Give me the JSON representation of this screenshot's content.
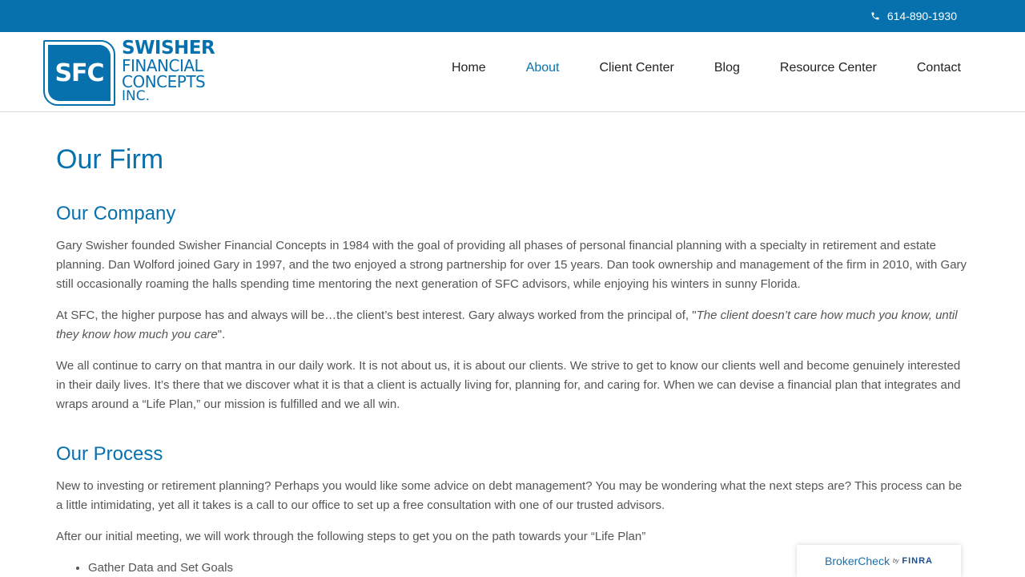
{
  "topbar": {
    "phone": "614-890-1930",
    "phone_icon": "phone-icon"
  },
  "logo": {
    "mark": "SFC",
    "line1": "SWISHER",
    "line2": "FINANCIAL",
    "line3": "CONCEPTS",
    "line4": "INC."
  },
  "nav": {
    "items": [
      "Home",
      "About",
      "Client Center",
      "Blog",
      "Resource Center",
      "Contact"
    ],
    "active": "About"
  },
  "page": {
    "title": "Our Firm",
    "company": {
      "heading": "Our Company",
      "p1": "Gary Swisher founded Swisher Financial Concepts in 1984 with the goal of providing all phases of personal financial planning with a specialty in retirement and estate planning. Dan Wolford joined Gary in 1997, and the two enjoyed a strong partnership for over 15 years. Dan took ownership and management of the firm in 2010, with Gary still occasionally roaming the halls spending time mentoring the next generation of SFC advisors, while enjoying his winters in sunny Florida.",
      "p2_lead": "At SFC, the higher purpose has and always will be…the client’s best interest. Gary always worked from the principal of, \"",
      "p2_quote": "The client doesn’t care how much you know, until they know how much you care",
      "p2_tail": "\".",
      "p3": "We all continue to carry on that mantra in our daily work. It is not about us, it is about our clients. We strive to get to know our clients well and become genuinely interested in their daily lives. It’s there that we discover what it is that a client is actually living for, planning for, and caring for. When we can devise a financial plan that integrates and wraps around a “Life Plan,” our mission is fulfilled and we all win."
    },
    "process": {
      "heading": "Our Process",
      "p1": "New to investing or retirement planning? Perhaps you would like some advice on debt management? You may be wondering what the next steps are? This process can be a little intimidating, yet all it takes is a call to our office to set up a free consultation with one of our trusted advisors.",
      "p2": "After our initial meeting, we will work through the following steps to get you on the path towards your “Life Plan”",
      "steps": [
        "Gather Data and Set Goals"
      ]
    }
  },
  "brokercheck": {
    "label": "BrokerCheck",
    "by": "by",
    "finra": "FINRA"
  },
  "colors": {
    "brand_blue": "#0771ae",
    "text": "#555555",
    "nav_text": "#222222"
  }
}
